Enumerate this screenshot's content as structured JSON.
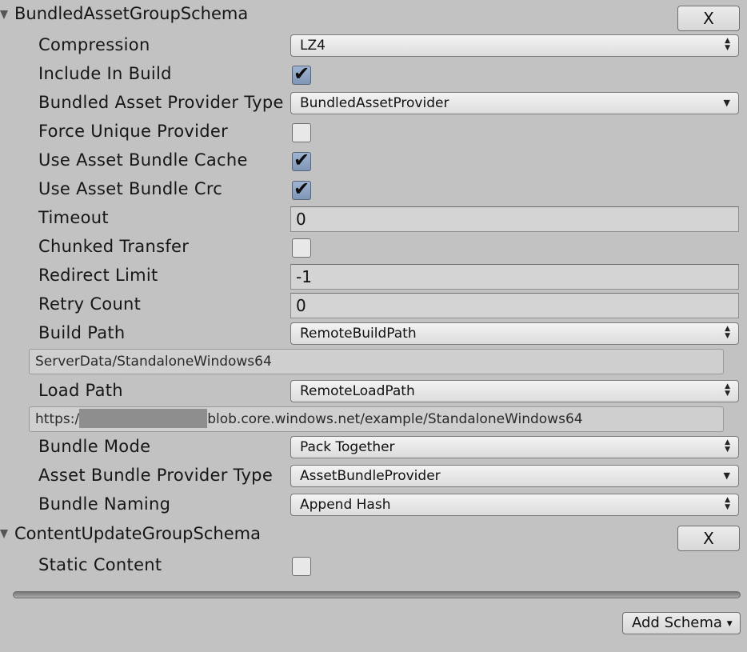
{
  "bundled_schema": {
    "title": "BundledAssetGroupSchema",
    "remove_label": "X",
    "compression": {
      "label": "Compression",
      "value": "LZ4"
    },
    "include_in_build": {
      "label": "Include In Build",
      "checked": true
    },
    "provider_type": {
      "label": "Bundled Asset Provider Type",
      "value": "BundledAssetProvider"
    },
    "force_unique": {
      "label": "Force Unique Provider",
      "checked": false
    },
    "use_cache": {
      "label": "Use Asset Bundle Cache",
      "checked": true
    },
    "use_crc": {
      "label": "Use Asset Bundle Crc",
      "checked": true
    },
    "timeout": {
      "label": "Timeout",
      "value": "0"
    },
    "chunked": {
      "label": "Chunked Transfer",
      "checked": false
    },
    "redirect": {
      "label": "Redirect Limit",
      "value": "-1"
    },
    "retry": {
      "label": "Retry Count",
      "value": "0"
    },
    "build_path": {
      "label": "Build Path",
      "value": "RemoteBuildPath",
      "resolved": "ServerData/StandaloneWindows64"
    },
    "load_path": {
      "label": "Load Path",
      "value": "RemoteLoadPath",
      "resolved_prefix": "https:/",
      "resolved_suffix": "blob.core.windows.net/example/StandaloneWindows64"
    },
    "bundle_mode": {
      "label": "Bundle Mode",
      "value": "Pack Together"
    },
    "bundle_provider": {
      "label": "Asset Bundle Provider Type",
      "value": "AssetBundleProvider"
    },
    "bundle_naming": {
      "label": "Bundle Naming",
      "value": "Append Hash"
    }
  },
  "content_schema": {
    "title": "ContentUpdateGroupSchema",
    "remove_label": "X",
    "static_content": {
      "label": "Static Content",
      "checked": false
    }
  },
  "add_schema_label": "Add Schema",
  "icons": {
    "foldout": "triangle-down-icon",
    "check": "checkmark-icon",
    "popup": "updown-arrow-icon",
    "dropdown": "down-arrow-icon"
  }
}
